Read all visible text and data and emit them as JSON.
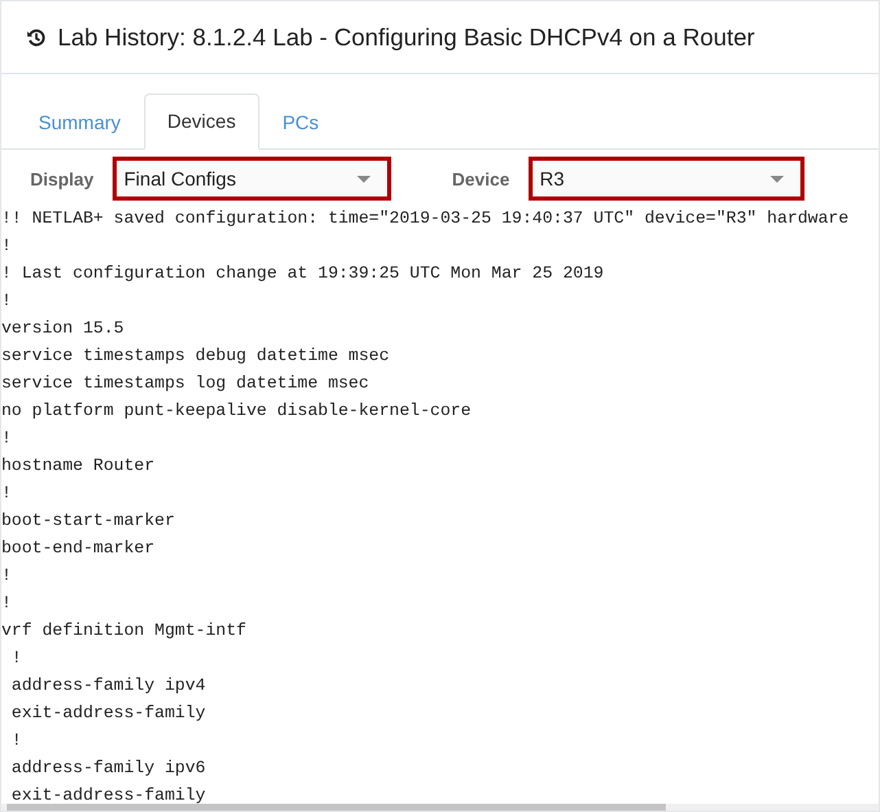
{
  "window": {
    "title": "Lab History: 8.1.2.4 Lab - Configuring Basic DHCPv4 on a Router"
  },
  "tabs": [
    {
      "label": "Summary",
      "selected": false
    },
    {
      "label": "Devices",
      "selected": true
    },
    {
      "label": "PCs",
      "selected": false
    }
  ],
  "filters": [
    {
      "label": "Display",
      "value": "Final Configs"
    },
    {
      "label": "Device",
      "value": "R3"
    }
  ],
  "config_lines": [
    "!! NETLAB+ saved configuration: time=\"2019-03-25 19:40:37 UTC\" device=\"R3\" hardware",
    "!",
    "! Last configuration change at 19:39:25 UTC Mon Mar 25 2019",
    "!",
    "version 15.5",
    "service timestamps debug datetime msec",
    "service timestamps log datetime msec",
    "no platform punt-keepalive disable-kernel-core",
    "!",
    "hostname Router",
    "!",
    "boot-start-marker",
    "boot-end-marker",
    "!",
    "!",
    "vrf definition Mgmt-intf",
    " !",
    " address-family ipv4",
    " exit-address-family",
    " !",
    " address-family ipv6",
    " exit-address-family"
  ]
}
